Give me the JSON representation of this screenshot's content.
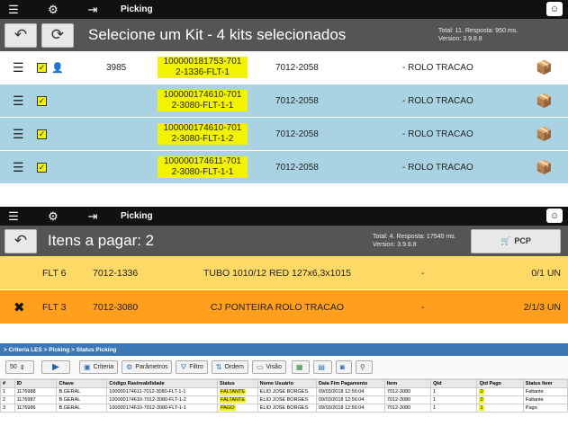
{
  "panel1": {
    "topbar": {
      "title": "Picking",
      "menu_icon": "menu-icon",
      "gear_icon": "gear-icon",
      "login_icon": "login-icon",
      "profile_icon": "profile-icon"
    },
    "header": {
      "title": "Selecione um Kit - 4 kits selecionados",
      "info_line1": "Total: 11. Resposta: 950 ms.",
      "info_line2": "Version: 3.9.8.8"
    },
    "rows": [
      {
        "num": "3985",
        "code1": "100000181753-701",
        "code2": "2-1336-FLT-1",
        "item": "7012-2058",
        "desc": "- ROLO TRACAO",
        "bg": "#ffffff",
        "person": true
      },
      {
        "num": "",
        "code1": "100000174610-701",
        "code2": "2-3080-FLT-1-1",
        "item": "7012-2058",
        "desc": "- ROLO TRACAO",
        "bg": "#a9d3e3",
        "person": false
      },
      {
        "num": "",
        "code1": "100000174610-701",
        "code2": "2-3080-FLT-1-2",
        "item": "7012-2058",
        "desc": "- ROLO TRACAO",
        "bg": "#a9d3e3",
        "person": false
      },
      {
        "num": "",
        "code1": "100000174611-701",
        "code2": "2-3080-FLT-1-1",
        "item": "7012-2058",
        "desc": "- ROLO TRACAO",
        "bg": "#a9d3e3",
        "person": false
      }
    ]
  },
  "panel2": {
    "topbar": {
      "title": "Picking"
    },
    "header": {
      "title": "Itens a pagar: 2",
      "info_line1": "Total: 4. Resposta: 17540 ms.",
      "info_line2": "Version: 3.9.8.8",
      "pcp_label": "PCP"
    },
    "rows": [
      {
        "mark": "",
        "flt": "FLT 6",
        "item": "7012-1336",
        "desc": "TUBO 1010/12 RED 127x6,3x1015",
        "dash": "-",
        "qty": "0/1 UN",
        "bg": "#ffd966"
      },
      {
        "mark": "✖",
        "flt": "FLT 3",
        "item": "7012-3080",
        "desc": "CJ PONTEIRA ROLO TRACAO",
        "dash": "-",
        "qty": "2/1/3 UN",
        "bg": "#ff9f1c"
      }
    ]
  },
  "panel3": {
    "breadcrumb": "> Criteria LES > Picking > Status Picking",
    "page_size": "50",
    "toolbar": [
      "Criteria",
      "Parâmetros",
      "Filtro",
      "Ordem",
      "Visão"
    ],
    "columns": [
      "#",
      "ID",
      "Chave",
      "Código Rastreabilidade",
      "Status",
      "Nome Usuário",
      "Data Fim Pagamento",
      "Item",
      "Qtd",
      "Qtd Pago",
      "Status Item"
    ],
    "rows": [
      [
        "1",
        "1176988",
        "B.GERAL",
        "100000174611-7012-3080-FLT-1-1",
        "FALTANTE",
        "ELIO JOSE BORGES",
        "09/03/2018 12:56:04",
        "7012-3080",
        "1",
        "0",
        "Faltante"
      ],
      [
        "2",
        "1176987",
        "B.GERAL",
        "100000174610-7012-3080-FLT-1-2",
        "FALTANTE",
        "ELIO JOSE BORGES",
        "09/03/2018 12:56:04",
        "7012-3080",
        "1",
        "0",
        "Faltante"
      ],
      [
        "3",
        "1176986",
        "B.GERAL",
        "100000174610-7012-3080-FLT-1-1",
        "PAGO",
        "ELIO JOSE BORGES",
        "09/03/2018 12:56:04",
        "7012-3080",
        "1",
        "1",
        "Pago"
      ]
    ]
  }
}
